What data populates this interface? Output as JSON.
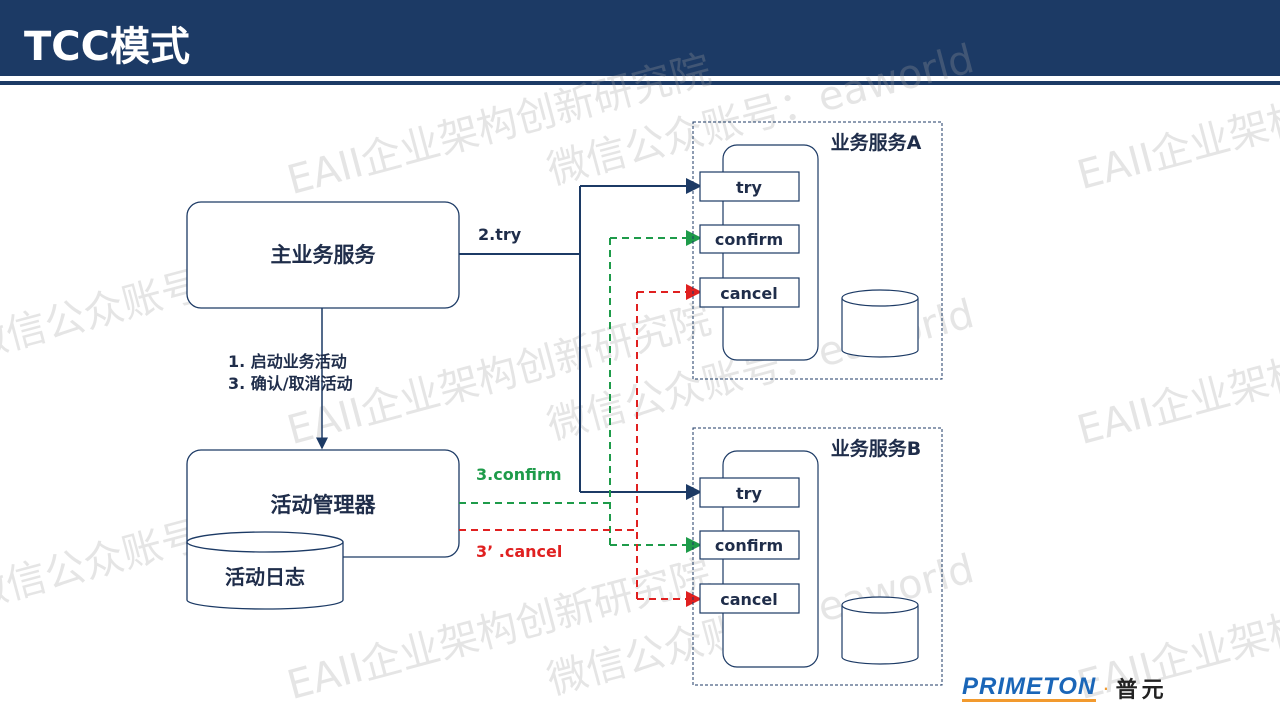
{
  "header": {
    "title": "TCC模式"
  },
  "watermark": {
    "line1": "EAII企业架构创新研究院",
    "line2": "微信公众账号：eaworld"
  },
  "main_service": {
    "label": "主业务服务"
  },
  "activity_manager": {
    "label": "活动管理器"
  },
  "activity_log": {
    "label": "活动日志"
  },
  "flow_labels": {
    "step1": "1. 启动业务活动",
    "step3": "3. 确认/取消活动",
    "try": "2.try",
    "confirm": "3.confirm",
    "cancel": "3’ .cancel"
  },
  "service_a": {
    "title": "业务服务A",
    "ops": [
      "try",
      "confirm",
      "cancel"
    ]
  },
  "service_b": {
    "title": "业务服务B",
    "ops": [
      "try",
      "confirm",
      "cancel"
    ]
  },
  "colors": {
    "navy": "#1c3a65",
    "confirm": "#1e9b4a",
    "cancel": "#e02020"
  },
  "logo": {
    "en": "PRIMETON",
    "cn": "普元"
  }
}
